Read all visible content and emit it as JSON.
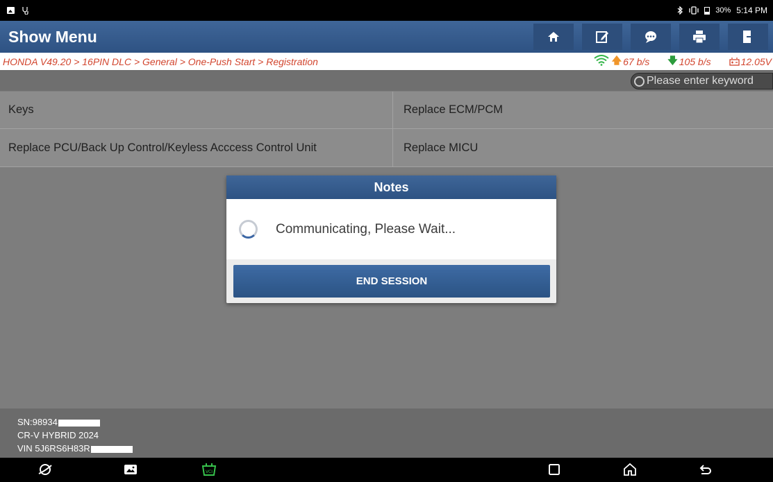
{
  "status_bar": {
    "battery": "30%",
    "time": "5:14 PM"
  },
  "app": {
    "title": "Show Menu",
    "toolbar": [
      "home-icon",
      "edit-icon",
      "chat-icon",
      "print-icon",
      "exit-icon"
    ]
  },
  "breadcrumb": "HONDA V49.20 > 16PIN DLC > General > One-Push Start > Registration",
  "connection": {
    "upload": "67 b/s",
    "download": "105 b/s",
    "voltage": "12.05V"
  },
  "search": {
    "placeholder": "Please enter keyword"
  },
  "menu": {
    "rows": [
      [
        "Keys",
        "Replace ECM/PCM"
      ],
      [
        "Replace PCU/Back Up Control/Keyless Acccess Control Unit",
        "Replace MICU"
      ]
    ]
  },
  "dialog": {
    "title": "Notes",
    "message": "Communicating, Please Wait...",
    "button": "END SESSION"
  },
  "vehicle": {
    "sn": "SN:98934",
    "model": "CR-V HYBRID 2024",
    "vin": "VIN 5J6RS6H83R"
  },
  "colors": {
    "header_blue": "#3f6698",
    "crumb_red": "#d2452e",
    "upload_orange": "#f0962a",
    "download_green": "#2c9c3d"
  }
}
